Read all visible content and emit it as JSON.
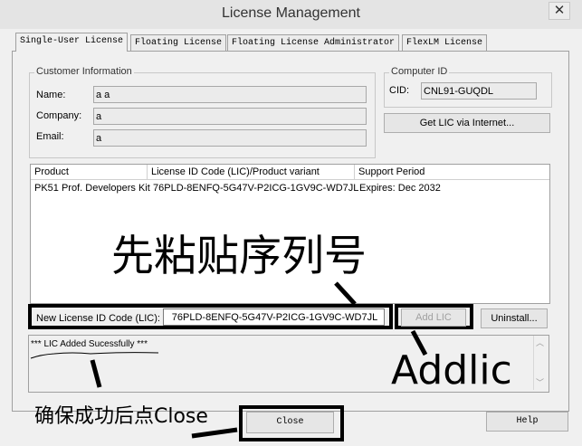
{
  "window": {
    "title": "License Management",
    "close_glyph": "✕"
  },
  "tabs": [
    {
      "label": "Single-User License",
      "active": true
    },
    {
      "label": "Floating License",
      "active": false
    },
    {
      "label": "Floating License Administrator",
      "active": false
    },
    {
      "label": "FlexLM License",
      "active": false
    }
  ],
  "customer": {
    "legend": "Customer Information",
    "name_label": "Name:",
    "name_value": "a a",
    "company_label": "Company:",
    "company_value": "a",
    "email_label": "Email:",
    "email_value": "a"
  },
  "computer": {
    "legend": "Computer ID",
    "cid_label": "CID:",
    "cid_value": "CNL91-GUQDL",
    "get_lic_button": "Get LIC via Internet..."
  },
  "table": {
    "headers": [
      "Product",
      "License ID Code (LIC)/Product variant",
      "Support Period"
    ],
    "rows": [
      [
        "PK51 Prof. Developers Kit",
        "76PLD-8ENFQ-5G47V-P2ICG-1GV9C-WD7JL",
        "Expires: Dec 2032"
      ]
    ]
  },
  "new_lic": {
    "label": "New License ID Code (LIC):",
    "value": "76PLD-8ENFQ-5G47V-P2ICG-1GV9C-WD7JL",
    "add_button": "Add LIC",
    "uninstall_button": "Uninstall..."
  },
  "log": {
    "text": "*** LIC Added Sucessfully ***"
  },
  "bottom": {
    "close_button": "Close",
    "help_button": "Help"
  },
  "annotations": {
    "paste_serial": "先粘贴序列号",
    "add_lic": "Addlic",
    "ensure_close": "确保成功后点Close"
  },
  "colors": {
    "annotation_black": "#000000"
  }
}
